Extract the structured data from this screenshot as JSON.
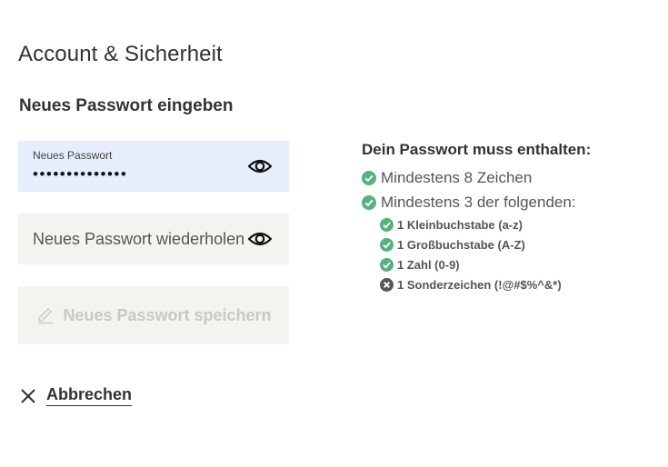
{
  "page_title": "Account & Sicherheit",
  "section_title": "Neues Passwort eingeben",
  "password_field": {
    "label": "Neues Passwort",
    "value": "••••••••••••••"
  },
  "confirm_field": {
    "placeholder": "Neues Passwort wiederholen"
  },
  "save_button": {
    "label": "Neues Passwort speichern"
  },
  "cancel_link": {
    "label": "Abbrechen"
  },
  "requirements": {
    "title": "Dein Passwort muss enthalten:",
    "items": [
      {
        "label": "Mindestens 8 Zeichen",
        "status": "ok"
      },
      {
        "label": "Mindestens 3 der folgenden:",
        "status": "ok"
      }
    ],
    "sub_items": [
      {
        "label": "1 Kleinbuchstabe (a-z)",
        "status": "ok"
      },
      {
        "label": "1 Großbuchstabe (A-Z)",
        "status": "ok"
      },
      {
        "label": "1 Zahl (0-9)",
        "status": "ok"
      },
      {
        "label": "1 Sonderzeichen (!@#$%^&*)",
        "status": "missing"
      }
    ]
  },
  "colors": {
    "ok": "#56b17e",
    "missing": "#58585a",
    "field_active_bg": "#e6eefc",
    "field_bg": "#f3f3ef",
    "disabled_text": "#c8c8c4"
  },
  "icons": {
    "visibility": "eye-icon",
    "save": "pencil-icon",
    "cancel": "close-icon",
    "ok": "check-circle-icon",
    "missing": "x-circle-icon"
  }
}
